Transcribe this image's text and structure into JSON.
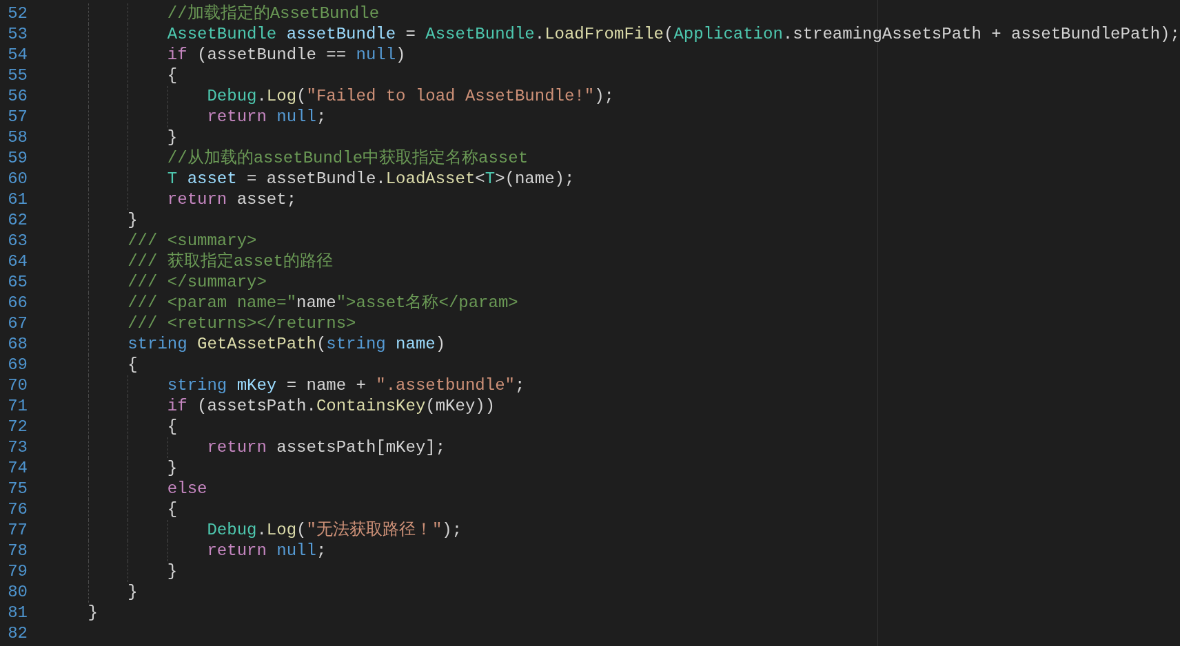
{
  "editor": {
    "lines": [
      {
        "number": "52",
        "tokens": [
          {
            "kind": "comment",
            "text": "            //加载指定的AssetBundle"
          }
        ]
      },
      {
        "number": "53",
        "tokens": [
          {
            "kind": "type",
            "text": "            AssetBundle "
          },
          {
            "kind": "variable",
            "text": "assetBundle"
          },
          {
            "kind": "plain",
            "text": " = "
          },
          {
            "kind": "type",
            "text": "AssetBundle"
          },
          {
            "kind": "plain",
            "text": "."
          },
          {
            "kind": "function",
            "text": "LoadFromFile"
          },
          {
            "kind": "plain",
            "text": "("
          },
          {
            "kind": "type",
            "text": "Application"
          },
          {
            "kind": "plain",
            "text": ".streamingAssetsPath + assetBundlePath);"
          }
        ]
      },
      {
        "number": "54",
        "tokens": [
          {
            "kind": "keyword",
            "text": "            if"
          },
          {
            "kind": "plain",
            "text": " (assetBundle == "
          },
          {
            "kind": "builtin",
            "text": "null"
          },
          {
            "kind": "plain",
            "text": ")"
          }
        ]
      },
      {
        "number": "55",
        "tokens": [
          {
            "kind": "plain",
            "text": "            {"
          }
        ]
      },
      {
        "number": "56",
        "tokens": [
          {
            "kind": "type",
            "text": "                Debug"
          },
          {
            "kind": "plain",
            "text": "."
          },
          {
            "kind": "function",
            "text": "Log"
          },
          {
            "kind": "plain",
            "text": "("
          },
          {
            "kind": "string",
            "text": "\"Failed to load AssetBundle!\""
          },
          {
            "kind": "plain",
            "text": ");"
          }
        ]
      },
      {
        "number": "57",
        "tokens": [
          {
            "kind": "keyword",
            "text": "                return "
          },
          {
            "kind": "builtin",
            "text": "null"
          },
          {
            "kind": "plain",
            "text": ";"
          }
        ]
      },
      {
        "number": "58",
        "tokens": [
          {
            "kind": "plain",
            "text": "            }"
          }
        ]
      },
      {
        "number": "59",
        "tokens": [
          {
            "kind": "comment",
            "text": "            //从加载的assetBundle中获取指定名称asset"
          }
        ]
      },
      {
        "number": "60",
        "tokens": [
          {
            "kind": "type",
            "text": "            T "
          },
          {
            "kind": "variable",
            "text": "asset"
          },
          {
            "kind": "plain",
            "text": " = assetBundle."
          },
          {
            "kind": "function",
            "text": "LoadAsset"
          },
          {
            "kind": "plain",
            "text": "<"
          },
          {
            "kind": "type",
            "text": "T"
          },
          {
            "kind": "plain",
            "text": ">(name);"
          }
        ]
      },
      {
        "number": "61",
        "tokens": [
          {
            "kind": "keyword",
            "text": "            return"
          },
          {
            "kind": "plain",
            "text": " asset;"
          }
        ]
      },
      {
        "number": "62",
        "tokens": [
          {
            "kind": "plain",
            "text": "        }"
          }
        ]
      },
      {
        "number": "63",
        "tokens": [
          {
            "kind": "comment",
            "text": "        /// <summary>"
          }
        ]
      },
      {
        "number": "64",
        "tokens": [
          {
            "kind": "comment",
            "text": "        /// 获取指定asset的路径"
          }
        ]
      },
      {
        "number": "65",
        "tokens": [
          {
            "kind": "comment",
            "text": "        /// </summary>"
          }
        ]
      },
      {
        "number": "66",
        "tokens": [
          {
            "kind": "comment",
            "text": "        /// <param name=\""
          },
          {
            "kind": "plain",
            "text": "name"
          },
          {
            "kind": "comment",
            "text": "\">asset名称</param>"
          }
        ]
      },
      {
        "number": "67",
        "tokens": [
          {
            "kind": "comment",
            "text": "        /// <returns></returns>"
          }
        ]
      },
      {
        "number": "68",
        "tokens": [
          {
            "kind": "builtin",
            "text": "        string "
          },
          {
            "kind": "function",
            "text": "GetAssetPath"
          },
          {
            "kind": "plain",
            "text": "("
          },
          {
            "kind": "builtin",
            "text": "string "
          },
          {
            "kind": "variable",
            "text": "name"
          },
          {
            "kind": "plain",
            "text": ")"
          }
        ]
      },
      {
        "number": "69",
        "tokens": [
          {
            "kind": "plain",
            "text": "        {"
          }
        ]
      },
      {
        "number": "70",
        "tokens": [
          {
            "kind": "builtin",
            "text": "            string "
          },
          {
            "kind": "variable",
            "text": "mKey"
          },
          {
            "kind": "plain",
            "text": " = name + "
          },
          {
            "kind": "string",
            "text": "\".assetbundle\""
          },
          {
            "kind": "plain",
            "text": ";"
          }
        ]
      },
      {
        "number": "71",
        "tokens": [
          {
            "kind": "keyword",
            "text": "            if"
          },
          {
            "kind": "plain",
            "text": " (assetsPath."
          },
          {
            "kind": "function",
            "text": "ContainsKey"
          },
          {
            "kind": "plain",
            "text": "(mKey))"
          }
        ]
      },
      {
        "number": "72",
        "tokens": [
          {
            "kind": "plain",
            "text": "            {"
          }
        ]
      },
      {
        "number": "73",
        "tokens": [
          {
            "kind": "keyword",
            "text": "                return"
          },
          {
            "kind": "plain",
            "text": " assetsPath[mKey];"
          }
        ]
      },
      {
        "number": "74",
        "tokens": [
          {
            "kind": "plain",
            "text": "            }"
          }
        ]
      },
      {
        "number": "75",
        "tokens": [
          {
            "kind": "keyword",
            "text": "            else"
          }
        ]
      },
      {
        "number": "76",
        "tokens": [
          {
            "kind": "plain",
            "text": "            {"
          }
        ]
      },
      {
        "number": "77",
        "tokens": [
          {
            "kind": "type",
            "text": "                Debug"
          },
          {
            "kind": "plain",
            "text": "."
          },
          {
            "kind": "function",
            "text": "Log"
          },
          {
            "kind": "plain",
            "text": "("
          },
          {
            "kind": "string",
            "text": "\"无法获取路径！\""
          },
          {
            "kind": "plain",
            "text": ");"
          }
        ]
      },
      {
        "number": "78",
        "tokens": [
          {
            "kind": "keyword",
            "text": "                return "
          },
          {
            "kind": "builtin",
            "text": "null"
          },
          {
            "kind": "plain",
            "text": ";"
          }
        ]
      },
      {
        "number": "79",
        "tokens": [
          {
            "kind": "plain",
            "text": "            }"
          }
        ]
      },
      {
        "number": "80",
        "tokens": [
          {
            "kind": "plain",
            "text": "        }"
          }
        ]
      },
      {
        "number": "81",
        "tokens": [
          {
            "kind": "plain",
            "text": "    }"
          }
        ]
      },
      {
        "number": "82"
      }
    ]
  }
}
